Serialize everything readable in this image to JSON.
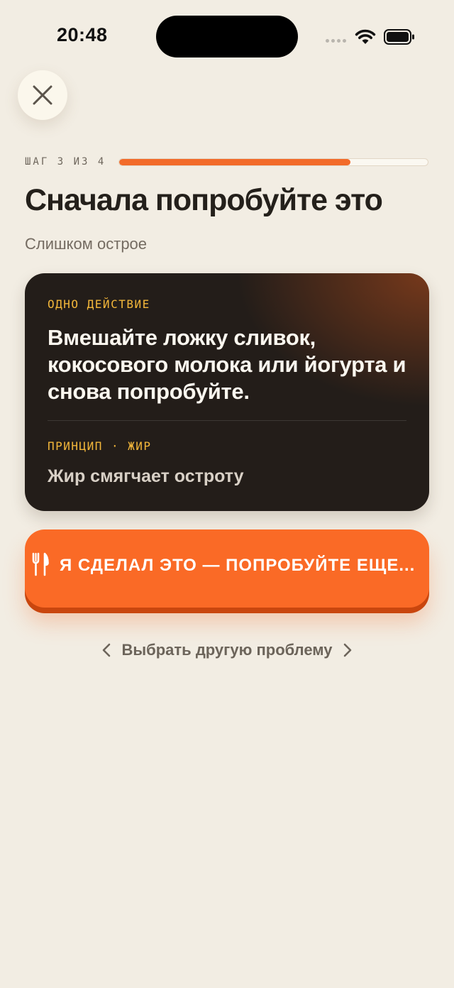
{
  "status_bar": {
    "time": "20:48"
  },
  "close_button": {
    "icon": "close-icon"
  },
  "progress": {
    "step_label": "ШАГ 3 ИЗ 4",
    "value": 0.75
  },
  "header": {
    "title": "Сначала попробуйте это",
    "subtitle": "Слишком острое"
  },
  "card": {
    "kicker": "ОДНО ДЕЙСТВИЕ",
    "action_text": "Вмешайте ложку сливок, кокосового молока или йогурта и снова попробуйте.",
    "principle_label": "ПРИНЦИП",
    "principle_separator": "·",
    "principle_tag": "ЖИР",
    "principle_text": "Жир смягчает остроту"
  },
  "cta": {
    "icon": "fork-knife-icon",
    "label": "Я СДЕЛАЛ ЭТО — ПОПРОБУЙТЕ ЕЩЕ..."
  },
  "alt_link": {
    "label": "Выбрать другую проблему"
  },
  "colors": {
    "background": "#f2ede3",
    "accent": "#fa6a26",
    "card": "#231d19",
    "kicker": "#f2b63a"
  }
}
